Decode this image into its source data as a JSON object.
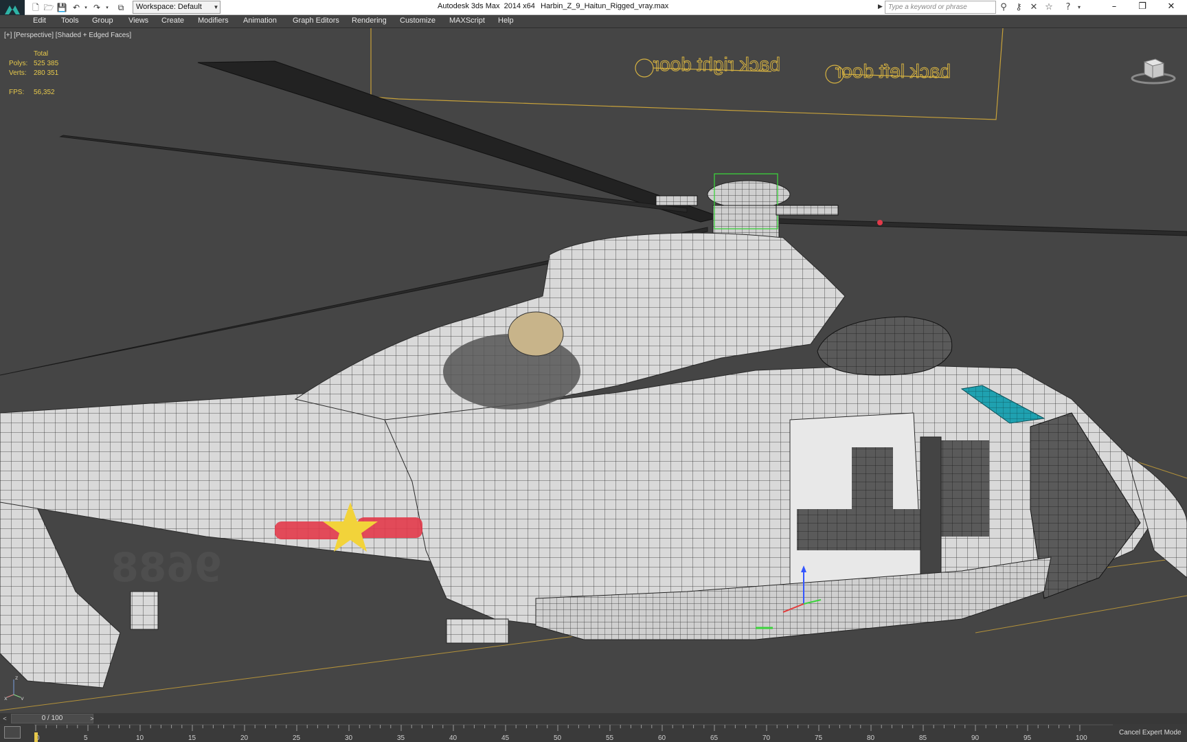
{
  "titlebar": {
    "app_title": "Autodesk 3ds Max  2014 x64",
    "file_name": "Harbin_Z_9_Haitun_Rigged_vray.max",
    "workspace_label": "Workspace: Default",
    "search_placeholder": "Type a keyword or phrase",
    "window_buttons": {
      "minimize": "–",
      "restore": "❐",
      "close": "✕"
    }
  },
  "menu": {
    "items": [
      "Edit",
      "Tools",
      "Group",
      "Views",
      "Create",
      "Modifiers",
      "Animation",
      "Graph Editors",
      "Rendering",
      "Customize",
      "MAXScript",
      "Help"
    ]
  },
  "viewport": {
    "label": "[+] [Perspective] [Shaded + Edged Faces]",
    "stats": {
      "header": "Total",
      "polys_label": "Polys:",
      "polys_value": "525 385",
      "verts_label": "Verts:",
      "verts_value": "280 351",
      "fps_label": "FPS:",
      "fps_value": "56,352"
    },
    "helper_text": {
      "right_door": "back right door",
      "left_door": "back left door"
    },
    "fuselage_number": "9688",
    "colors": {
      "background": "#454545",
      "stats_text": "#e7c94b",
      "helper_lines": "#c8a23a",
      "mesh_fill": "#d9d9d9",
      "mesh_edges": "#2a2a2a",
      "star_red": "#e23a4a",
      "star_yellow": "#f2d33a",
      "glass_teal": "#1fa1b0"
    }
  },
  "timeslider": {
    "frame_display": "0 / 100",
    "prev_label": "<",
    "next_label": ">"
  },
  "trackbar": {
    "ticks": [
      "0",
      "5",
      "10",
      "15",
      "20",
      "25",
      "30",
      "35",
      "40",
      "45",
      "50",
      "55",
      "60",
      "65",
      "70",
      "75",
      "80",
      "85",
      "90",
      "95",
      "100"
    ],
    "cancel_label": "Cancel Expert Mode"
  }
}
